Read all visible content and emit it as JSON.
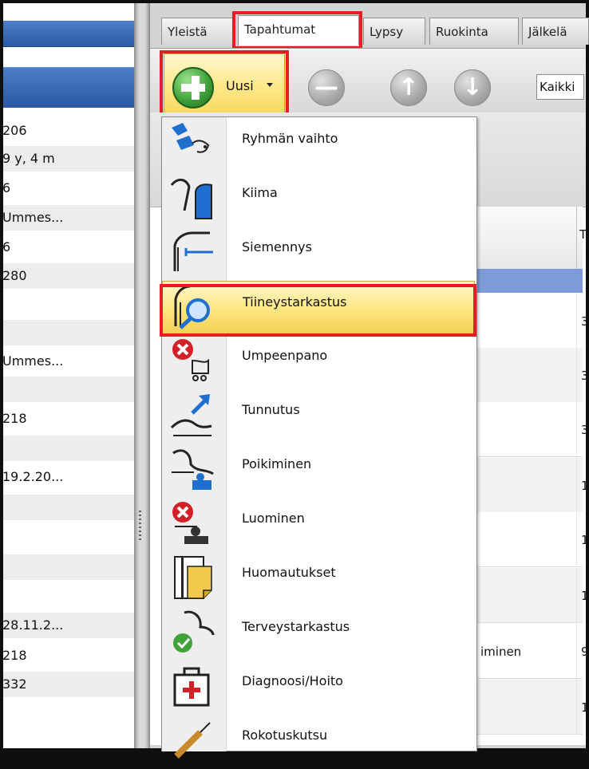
{
  "left_panel": {
    "values": [
      "206",
      "9 y, 4 m",
      "6",
      "Ummes...",
      "6",
      "280",
      "",
      "",
      "Ummes...",
      "",
      "218",
      "",
      "19.2.20...",
      "",
      "",
      "",
      "",
      "28.11.2...",
      "218",
      "332"
    ]
  },
  "tabs": [
    "Yleistä",
    "Tapahtumat",
    "Lypsy",
    "Ruokinta",
    "Jälkelä"
  ],
  "toolbar": {
    "new_label": "Uusi",
    "filter_value": "Kaikki"
  },
  "grid": {
    "header_partial": "T",
    "partial_values": [
      "3",
      "3",
      "3",
      "1",
      "1",
      "1",
      "9",
      "1"
    ],
    "partial_text_row7": "iminen"
  },
  "menu": {
    "items": [
      {
        "label": "Ryhmän vaihto",
        "icon": "group-change-icon"
      },
      {
        "label": "Kiima",
        "icon": "heat-icon"
      },
      {
        "label": "Siemennys",
        "icon": "insemination-icon"
      },
      {
        "label": "Tiineystarkastus",
        "icon": "pregnancy-check-icon"
      },
      {
        "label": "Umpeenpano",
        "icon": "dry-off-icon"
      },
      {
        "label": "Tunnutus",
        "icon": "induction-icon"
      },
      {
        "label": "Poikiminen",
        "icon": "calving-icon"
      },
      {
        "label": "Luominen",
        "icon": "abortion-icon"
      },
      {
        "label": "Huomautukset",
        "icon": "notes-icon"
      },
      {
        "label": "Terveystarkastus",
        "icon": "health-check-icon"
      },
      {
        "label": "Diagnoosi/Hoito",
        "icon": "diagnosis-icon"
      },
      {
        "label": "Rokotuskutsu",
        "icon": "vaccination-icon"
      }
    ]
  },
  "colors": {
    "highlight_red": "#e61d25",
    "menu_hover_yellow": "#ffe680",
    "header_blue": "#2c5aa5",
    "icon_blue": "#1f6fd0"
  }
}
